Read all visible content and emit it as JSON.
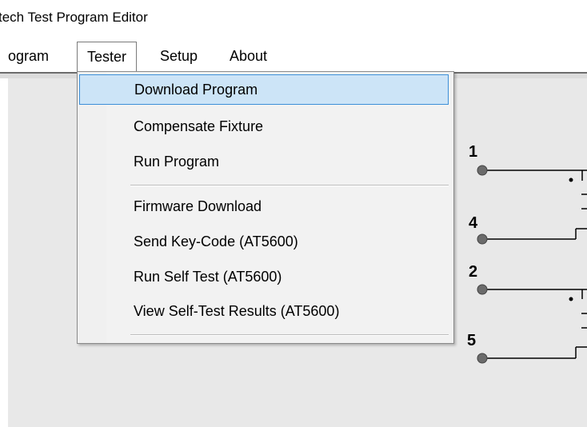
{
  "window": {
    "title": "tech Test Program Editor"
  },
  "menubar": {
    "items": [
      {
        "label": "ogram"
      },
      {
        "label": "Tester"
      },
      {
        "label": "Setup"
      },
      {
        "label": "About"
      }
    ]
  },
  "tester_menu": {
    "items": [
      {
        "label": "Download Program",
        "highlighted": true
      },
      {
        "label": "Compensate Fixture"
      },
      {
        "label": "Run Program"
      },
      {
        "label": "Firmware Download"
      },
      {
        "label": "Send Key-Code (AT5600)"
      },
      {
        "label": "Run Self Test (AT5600)"
      },
      {
        "label": "View Self-Test Results (AT5600)"
      }
    ]
  },
  "schematic": {
    "pins": [
      {
        "label": "1"
      },
      {
        "label": "4"
      },
      {
        "label": "2"
      },
      {
        "label": "5"
      }
    ]
  },
  "colors": {
    "highlight_fill": "#cce4f7",
    "highlight_border": "#3c8fd8",
    "workspace": "#e8e8e8",
    "pin": "#6b6b6b"
  }
}
